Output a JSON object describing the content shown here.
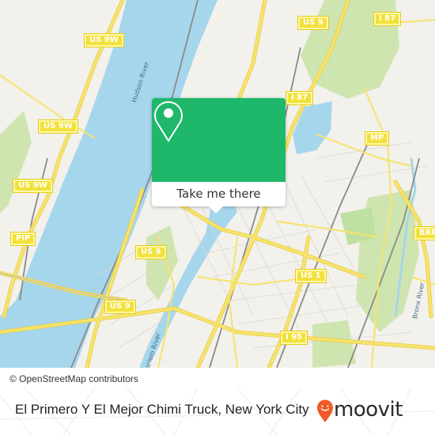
{
  "map": {
    "attribution": "© OpenStreetMap contributors",
    "colors": {
      "water": "#a6d6ec",
      "land": "#f2f1ec",
      "park": "#cfe5b0",
      "highway": "#f7e36b",
      "highway_casing": "#e6cc44",
      "rail": "#8a8a8a",
      "minor_road": "#ffffff",
      "shield_fill": "#f2e13a"
    },
    "road_shields": [
      {
        "id": "us9w-1",
        "label": "US 9W"
      },
      {
        "id": "us9w-2",
        "label": "US 9W"
      },
      {
        "id": "us9w-3",
        "label": "US 9W"
      },
      {
        "id": "pip",
        "label": "PIP"
      },
      {
        "id": "us9-top",
        "label": "US 9"
      },
      {
        "id": "i87-top",
        "label": "I 87"
      },
      {
        "id": "i87-mid",
        "label": "I 87"
      },
      {
        "id": "mp",
        "label": "MP"
      },
      {
        "id": "brp",
        "label": "BRP"
      },
      {
        "id": "us9-mid",
        "label": "US 9"
      },
      {
        "id": "us9-low",
        "label": "US 9"
      },
      {
        "id": "us1",
        "label": "US 1"
      },
      {
        "id": "i95",
        "label": "I 95"
      }
    ],
    "water_labels": {
      "hudson": "Hudson River",
      "harlem": "Harlem River",
      "bronx": "Bronx River"
    }
  },
  "popup": {
    "cta_label": "Take me there",
    "accent_color": "#1fb86b",
    "icon": "location-pin-icon"
  },
  "footer": {
    "place_title": "El Primero Y El Mejor Chimi Truck, New York City",
    "brand": "moovit",
    "brand_color": "#f05a28",
    "brand_icon": "moovit-smiley-pin-icon"
  }
}
